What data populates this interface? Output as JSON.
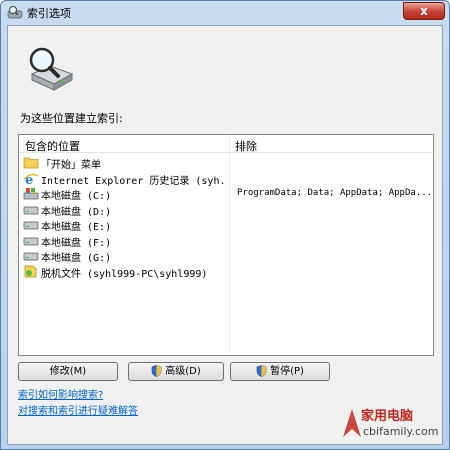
{
  "window": {
    "title": "索引选项",
    "close": "x"
  },
  "intro": "为这些位置建立索引:",
  "list": {
    "headers": {
      "included": "包含的位置",
      "exclude": "排除"
    },
    "rows": [
      {
        "icon": "folder-icon",
        "name": "「开始」菜单",
        "exclude": ""
      },
      {
        "icon": "ie-icon",
        "name": "Internet Explorer 历史记录 (syh...",
        "exclude": ""
      },
      {
        "icon": "system-drive-icon",
        "name": "本地磁盘 (C:)",
        "exclude": "ProgramData; Data; AppData; AppDa..."
      },
      {
        "icon": "drive-icon",
        "name": "本地磁盘 (D:)",
        "exclude": ""
      },
      {
        "icon": "drive-icon",
        "name": "本地磁盘 (E:)",
        "exclude": ""
      },
      {
        "icon": "drive-icon",
        "name": "本地磁盘 (F:)",
        "exclude": ""
      },
      {
        "icon": "drive-icon",
        "name": "本地磁盘 (G:)",
        "exclude": ""
      },
      {
        "icon": "offline-files-icon",
        "name": "脱机文件 (syhl999-PC\\syhl999)",
        "exclude": ""
      }
    ]
  },
  "buttons": {
    "modify": "修改(M)",
    "advanced": "高级(D)",
    "pause": "暂停(P)"
  },
  "links": {
    "affect_search": "索引如何影响搜索?",
    "troubleshoot": "对搜索和索引进行疑难解答"
  },
  "watermark": {
    "top": "家用电脑",
    "bottom": "cbifamily.com"
  }
}
